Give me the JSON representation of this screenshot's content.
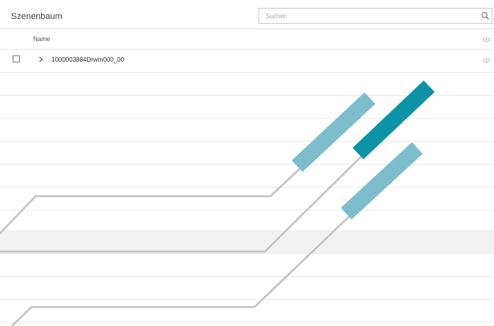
{
  "panel": {
    "title": "Szenenbaum",
    "search": {
      "placeholder": "Suchen",
      "value": ""
    },
    "columns": {
      "name": "Name"
    },
    "tree": [
      {
        "label": "1000003884Drwm000_00",
        "checked": false,
        "expanded": false
      }
    ]
  },
  "icons": {
    "search": "search-icon",
    "visibility": "eye-icon",
    "expand": "chevron-right-icon"
  },
  "colors": {
    "accent_light": "#7dbdcb",
    "accent_dark": "#0e93a6",
    "line_gray": "#c4c4c4",
    "row_shaded": "#f2f2f2"
  }
}
